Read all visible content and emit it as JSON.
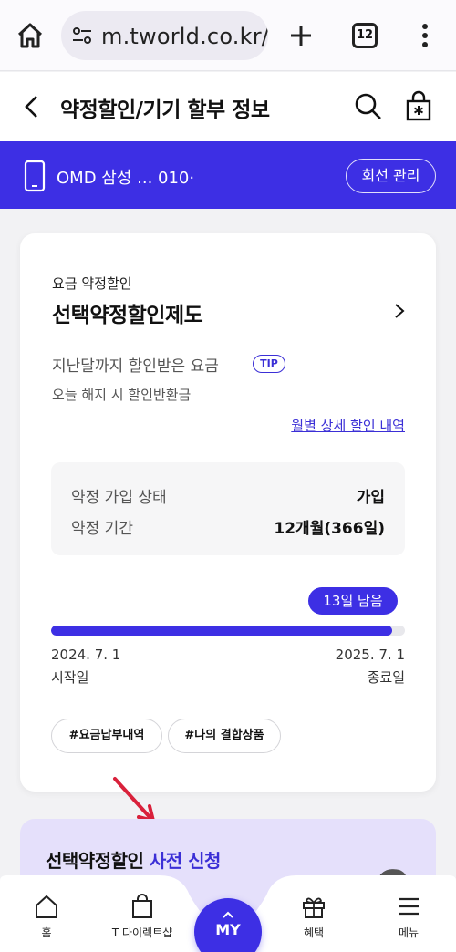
{
  "browser": {
    "url": "m.tworld.co.kr/i",
    "tab_count": "12"
  },
  "header": {
    "title": "약정할인/기기 할부 정보"
  },
  "line": {
    "text": "OMD 삼성 ...  010·",
    "manage_label": "회선 관리"
  },
  "contract": {
    "subtitle": "요금 약정할인",
    "title": "선택약정할인제도",
    "discount_label": "지난달까지 할인받은 요금",
    "tip_label": "TIP",
    "refund_label": "오늘 해지 시 할인반환금",
    "monthly_link": "월별 상세 할인 내역",
    "status_key": "약정 가입 상태",
    "status_value": "가입",
    "period_key": "약정 기간",
    "period_value": "12개월(366일)",
    "remaining_label": "13일 남음",
    "progress_fraction": 0.964,
    "start_date": "2024. 7. 1",
    "end_date": "2025. 7. 1",
    "start_label": "시작일",
    "end_label": "종료일",
    "chips": [
      "#요금납부내역",
      "#나의 결합상품"
    ]
  },
  "promo": {
    "text_main": "선택약정할인 ",
    "text_highlight": "사전 신청"
  },
  "nav": {
    "home": "홈",
    "shop": "T 다이렉트샵",
    "my": "MY",
    "benefit": "혜택",
    "menu": "메뉴"
  },
  "colors": {
    "accent": "#3d2fe4",
    "link": "#3b2fd6",
    "promo_bg": "#e5e0fb",
    "arrow": "#d9213b"
  }
}
